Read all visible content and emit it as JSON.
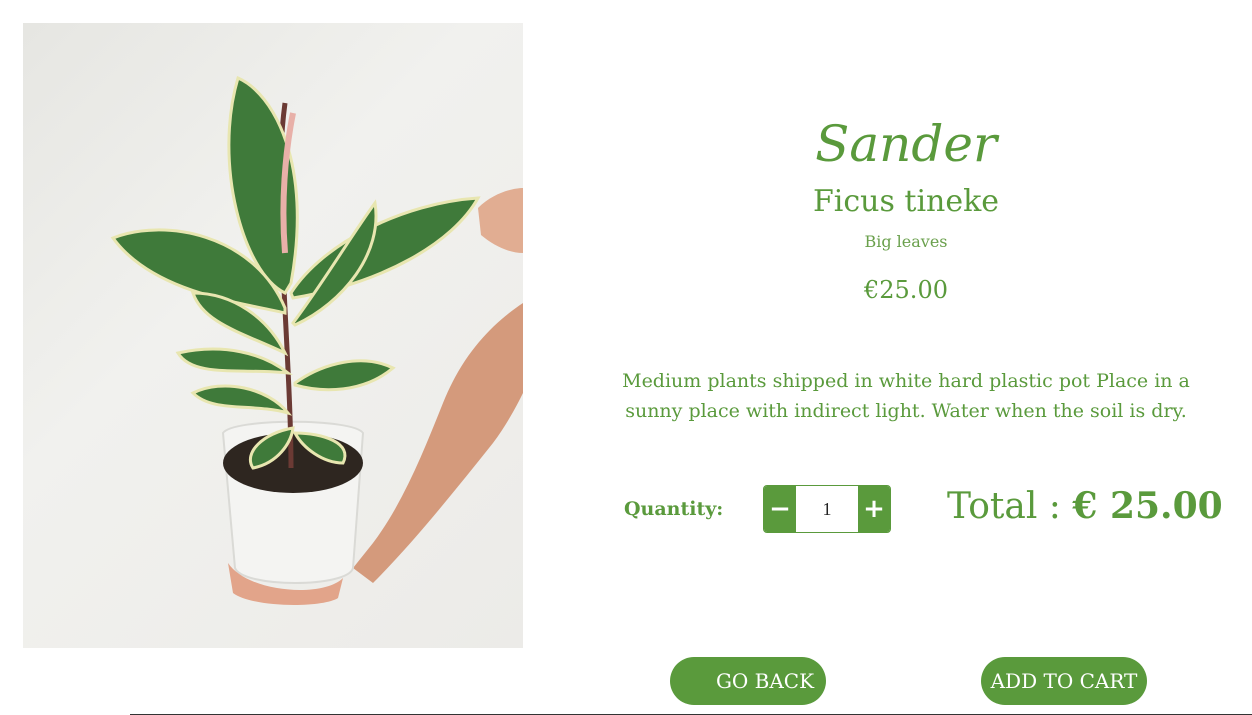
{
  "product": {
    "brand": "Sander",
    "species": "Ficus tineke",
    "tagline": "Big leaves",
    "price": "€25.00",
    "description": "Medium plants shipped in white hard plastic pot Place in a sunny place with indirect light. Water when the soil is dry."
  },
  "quantity": {
    "label": "Quantity:",
    "value": "1",
    "decrement_symbol": "−",
    "increment_symbol": "+"
  },
  "total": {
    "label": "Total :",
    "amount": "€ 25.00"
  },
  "actions": {
    "go_back_label": "GO BACK",
    "add_to_cart_label": "ADD TO CART"
  },
  "colors": {
    "accent": "#5a9a3c",
    "background": "#ffffff"
  },
  "icons": {
    "decrement": "minus-icon",
    "increment": "plus-icon"
  }
}
